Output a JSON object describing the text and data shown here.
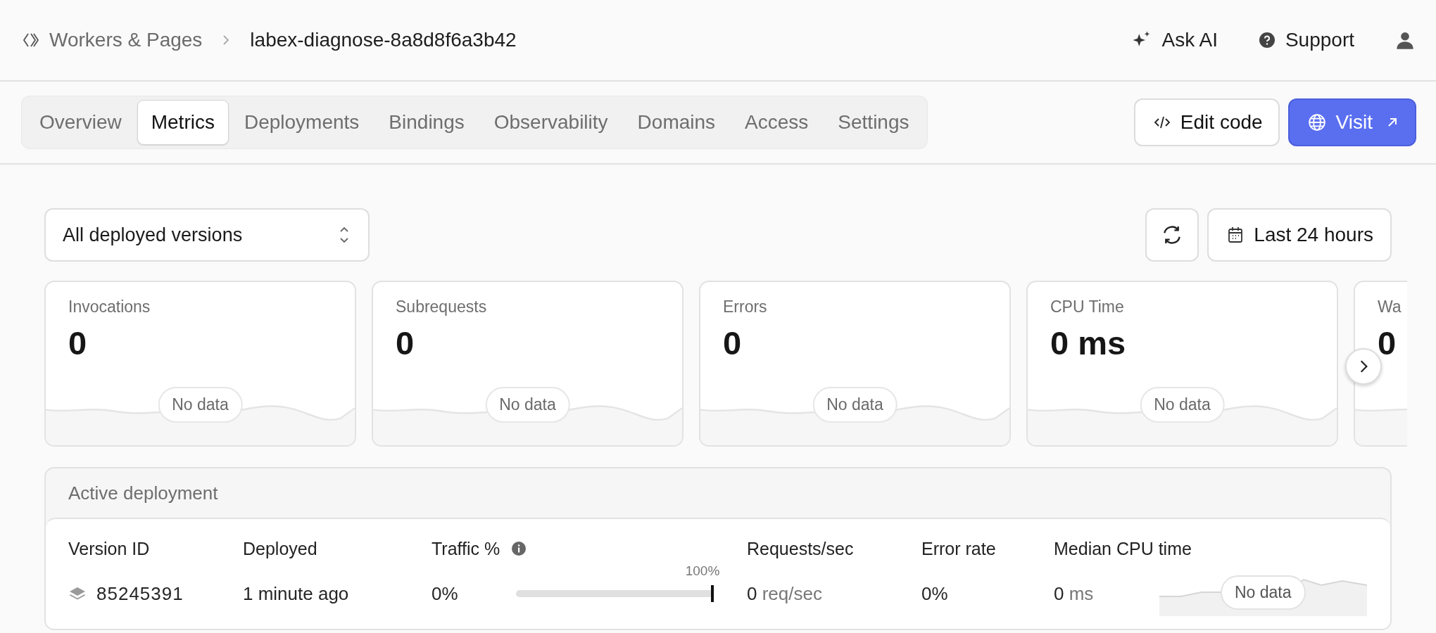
{
  "breadcrumb": {
    "parent": "Workers & Pages",
    "current": "labex-diagnose-8a8d8f6a3b42"
  },
  "header_actions": [
    {
      "kind": "ai",
      "label": "Ask AI"
    },
    {
      "kind": "support",
      "label": "Support"
    },
    {
      "kind": "account"
    }
  ],
  "tabs": [
    {
      "label": "Overview",
      "selected": false
    },
    {
      "label": "Metrics",
      "selected": true
    },
    {
      "label": "Deployments",
      "selected": false
    },
    {
      "label": "Bindings",
      "selected": false
    },
    {
      "label": "Observability",
      "selected": false
    },
    {
      "label": "Domains",
      "selected": false
    },
    {
      "label": "Access",
      "selected": false
    },
    {
      "label": "Settings",
      "selected": false
    }
  ],
  "actions": [
    {
      "kind": "edit",
      "label": "Edit code"
    },
    {
      "kind": "visit",
      "label": "Visit"
    }
  ],
  "version_filter": {
    "value": "All deployed versions"
  },
  "time_range": {
    "label": "Last 24 hours"
  },
  "metrics": [
    {
      "title": "Invocations",
      "value": "0",
      "note": "No data"
    },
    {
      "title": "Subrequests",
      "value": "0",
      "note": "No data"
    },
    {
      "title": "Errors",
      "value": "0",
      "note": "No data"
    },
    {
      "title": "CPU Time",
      "value": "0 ms",
      "note": "No data"
    },
    {
      "title": "Wa",
      "value": "0"
    }
  ],
  "active_deployment": {
    "title": "Active deployment",
    "columns": [
      "Version ID",
      "Deployed",
      "Traffic %",
      "Requests/sec",
      "Error rate",
      "Median CPU time"
    ],
    "row": {
      "version_id": "85245391",
      "deployed": "1 minute ago",
      "traffic": "0%",
      "traffic_bar": {
        "label": "100%",
        "level": 1
      },
      "requests": {
        "value": "0",
        "unit": "req/sec"
      },
      "error_rate": "0%",
      "cpu": {
        "value": "0",
        "unit": "ms"
      },
      "cpu_note": "No data"
    }
  }
}
